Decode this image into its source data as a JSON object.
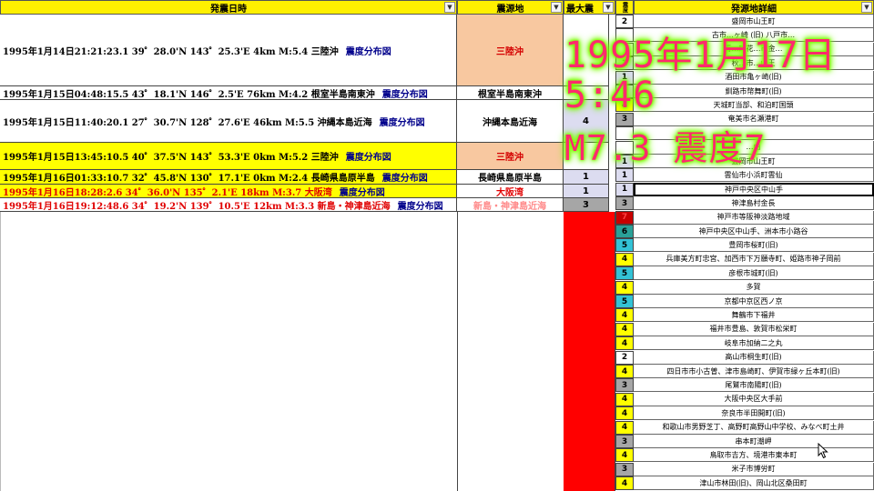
{
  "headers": {
    "date": "発震日時",
    "region": "震源地",
    "maxint": "最大震",
    "narrow": "震度",
    "detail": "発源地詳細"
  },
  "events": [
    {
      "text": "1995年1月14日21:21:23.1 39゜28.0'N 143゜25.3'E 4km M:5.4 三陸沖",
      "dist": "震度分布図",
      "region": "三陸沖",
      "maxint": "",
      "color": "#000000",
      "regionColor": "#d40000",
      "regionBg": "#f8c8a0",
      "rowBg": "#ffffff"
    },
    {
      "text": "1995年1月15日04:48:15.5 43゜18.1'N 146゜2.5'E 76km M:4.2 根室半島南東沖",
      "dist": "震度分布図",
      "region": "根室半島南東沖",
      "maxint": "",
      "color": "#000000",
      "regionColor": "#000000",
      "regionBg": "#ffffff",
      "rowBg": "#ffffff"
    },
    {
      "text": "1995年1月15日11:40:20.1 27゜30.7'N 128゜27.6'E 46km M:5.5 沖縄本島近海",
      "dist": "震度分布図",
      "region": "沖縄本島近海",
      "maxint": "4",
      "color": "#000000",
      "regionColor": "#000000",
      "regionBg": "#ffffff",
      "rowBg": "#ffffff"
    },
    {
      "text": "1995年1月15日13:45:10.5 40゜37.5'N 143゜53.3'E 0km M:5.2 三陸沖",
      "dist": "震度分布図",
      "region": "三陸沖",
      "maxint": "",
      "color": "#000000",
      "regionColor": "#d40000",
      "regionBg": "#f8c8a0",
      "rowBg": "#ffff00"
    },
    {
      "text": "1995年1月16日01:33:10.7 32゜45.8'N 130゜17.1'E 0km M:2.4 長崎県島原半島",
      "dist": "震度分布図",
      "region": "長崎県島原半島",
      "maxint": "1",
      "color": "#000000",
      "regionColor": "#000000",
      "regionBg": "#ffffff",
      "rowBg": "#ffff00"
    },
    {
      "text": "1995年1月16日18:28:2.6 34゜36.0'N 135゜2.1'E 18km M:3.7 大阪湾",
      "dist": "震度分布図",
      "region": "大阪湾",
      "maxint": "1",
      "color": "#e00000",
      "regionColor": "#e00000",
      "regionBg": "#ffffff",
      "rowBg": "#ffff00"
    },
    {
      "text": "1995年1月16日19:12:48.6 34゜19.2'N 139゜10.5'E 12km M:3.3 新島・神津島近海",
      "dist": "震度分布図",
      "region": "新島・神津島近海",
      "maxint": "3",
      "color": "#e00000",
      "regionColor": "#ff8a8a",
      "regionBg": "#ffffff",
      "rowBg": "#ffffff"
    }
  ],
  "details": [
    {
      "int": "2",
      "place": "盛岡市山王町"
    },
    {
      "int": "",
      "place": "古市…ヶ崎 (旧) 八戸市…"
    },
    {
      "int": "",
      "place": "青…町花…市金…"
    },
    {
      "int": "1",
      "place": "秋…市…山王"
    },
    {
      "int": "1",
      "place": "酒田市亀ヶ崎(旧)"
    },
    {
      "int": "1",
      "place": "釧路市幣舞町(旧)"
    },
    {
      "int": "4",
      "place": "天城町当部、和泊町国頭"
    },
    {
      "int": "3",
      "place": "奄美市名瀬港町"
    },
    {
      "int": "",
      "place": "…"
    },
    {
      "int": "",
      "place": "…由"
    },
    {
      "int": "1",
      "place": "盛岡市山王町"
    },
    {
      "int": "1",
      "place": "雲仙市小浜町雲仙"
    },
    {
      "int": "1",
      "place": "神戸中央区中山手"
    },
    {
      "int": "3",
      "place": "神津島村金長"
    },
    {
      "int": "7",
      "place": "神戸市等阪神淡路地域"
    },
    {
      "int": "6",
      "place": "神戸中央区中山手、洲本市小路谷"
    },
    {
      "int": "5",
      "place": "豊岡市桜町(旧)"
    },
    {
      "int": "4",
      "place": "兵庫美方町忠宮、加西市下万願寺町、姫路市神子岡前"
    },
    {
      "int": "5",
      "place": "彦根市城町(旧)"
    },
    {
      "int": "4",
      "place": "多賀"
    },
    {
      "int": "5",
      "place": "京都中京区西ノ京"
    },
    {
      "int": "4",
      "place": "舞鶴市下福井"
    },
    {
      "int": "4",
      "place": "福井市豊島、敦賀市松栄町"
    },
    {
      "int": "4",
      "place": "岐阜市加納二之丸"
    },
    {
      "int": "2",
      "place": "高山市桐生町(旧)"
    },
    {
      "int": "4",
      "place": "四日市市小古曽、津市島崎町、伊賀市緑ヶ丘本町(旧)"
    },
    {
      "int": "3",
      "place": "尾鷲市南陽町(旧)"
    },
    {
      "int": "4",
      "place": "大阪中央区大手前"
    },
    {
      "int": "4",
      "place": "奈良市半田開町(旧)"
    },
    {
      "int": "4",
      "place": "和歌山市男野芝丁、高野町高野山中学校、みなべ町土井"
    },
    {
      "int": "3",
      "place": "串本町潮岬"
    },
    {
      "int": "4",
      "place": "鳥取市吉方、境港市東本町"
    },
    {
      "int": "3",
      "place": "米子市博労町"
    },
    {
      "int": "4",
      "place": "津山市林田(旧)、岡山北区桑田町"
    }
  ],
  "overlay": {
    "line1": "1995年1月17日",
    "line2": "5:46",
    "line3": "M7.3  震度7"
  },
  "colors": {
    "header": "#fff000",
    "int7": "#c80000",
    "int6": "#2aa198",
    "int5": "#33c2d6",
    "int4": "#ffff00",
    "int3": "#a6a6a6",
    "int2": "#ffffff",
    "int1": "#dcdcf0",
    "overlayText": "#ff2a6d",
    "overlayGlow": "#7cff00"
  }
}
